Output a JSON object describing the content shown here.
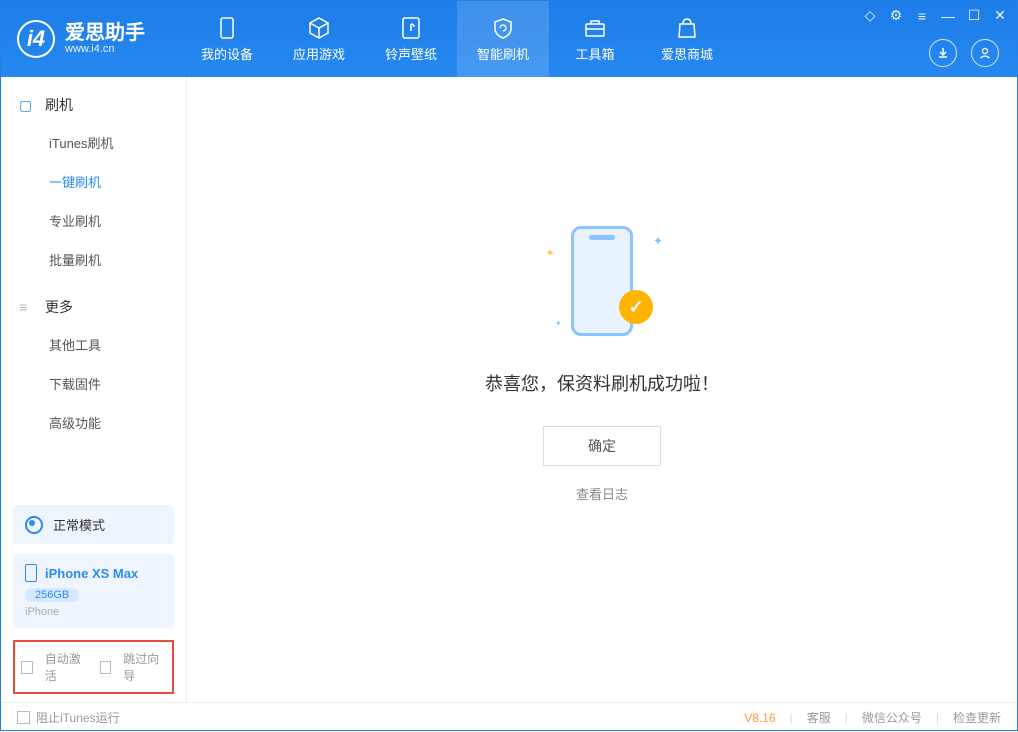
{
  "app": {
    "title": "爱思助手",
    "url": "www.i4.cn"
  },
  "nav": {
    "items": [
      {
        "label": "我的设备"
      },
      {
        "label": "应用游戏"
      },
      {
        "label": "铃声壁纸"
      },
      {
        "label": "智能刷机"
      },
      {
        "label": "工具箱"
      },
      {
        "label": "爱思商城"
      }
    ]
  },
  "sidebar": {
    "section1": {
      "title": "刷机",
      "items": [
        "iTunes刷机",
        "一键刷机",
        "专业刷机",
        "批量刷机"
      ]
    },
    "section2": {
      "title": "更多",
      "items": [
        "其他工具",
        "下载固件",
        "高级功能"
      ]
    }
  },
  "device": {
    "mode": "正常模式",
    "name": "iPhone XS Max",
    "capacity": "256GB",
    "type": "iPhone"
  },
  "options": {
    "auto_activate": "自动激活",
    "skip_guide": "跳过向导"
  },
  "main": {
    "success_text": "恭喜您，保资料刷机成功啦！",
    "confirm": "确定",
    "view_log": "查看日志"
  },
  "footer": {
    "block_itunes": "阻止iTunes运行",
    "version": "V8.16",
    "service": "客服",
    "wechat": "微信公众号",
    "update": "检查更新"
  }
}
